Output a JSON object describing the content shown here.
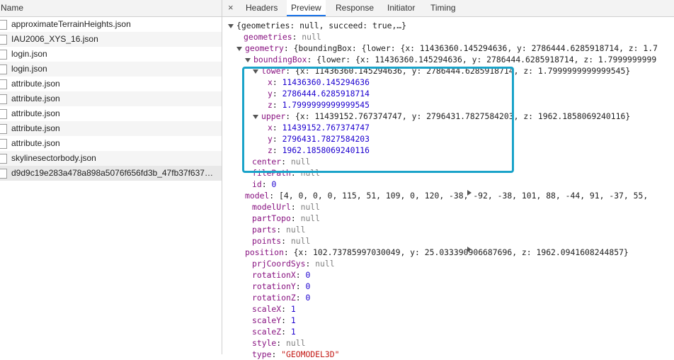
{
  "left_panel": {
    "header": "Name",
    "files": [
      "approximateTerrainHeights.json",
      "IAU2006_XYS_16.json",
      "login.json",
      "login.json",
      "attribute.json",
      "attribute.json",
      "attribute.json",
      "attribute.json",
      "attribute.json",
      "skylinesectorbody.json",
      "d9d9c19e283a478a898a5076f656fd3b_47fb37f637…"
    ]
  },
  "tabs": {
    "close": "×",
    "items": [
      "Headers",
      "Preview",
      "Response",
      "Initiator",
      "Timing"
    ],
    "active": "Preview"
  },
  "preview": {
    "root": "{geometries: null, succeed: true,…}",
    "geometries_key": "geometries",
    "geometry_key": "geometry",
    "geometry_summary": "{boundingBox: {lower: {x: 11436360.145294636, y: 2786444.6285918714, z: 1.7",
    "boundingBox_key": "boundingBox",
    "boundingBox_summary": "{lower: {x: 11436360.145294636, y: 2786444.6285918714, z: 1.7999999999",
    "lower_key": "lower",
    "lower_summary": "{x: 11436360.145294636, y: 2786444.6285918714, z: 1.7999999999999545}",
    "lower_x": "11436360.145294636",
    "lower_y": "2786444.6285918714",
    "lower_z": "1.7999999999999545",
    "upper_key": "upper",
    "upper_summary": "{x: 11439152.767374747, y: 2796431.7827584203, z: 1962.1858069240116}",
    "upper_x": "11439152.767374747",
    "upper_y": "2796431.7827584203",
    "upper_z": "1962.1858069240116",
    "null_text": "null",
    "id_val": "0",
    "model_summary": "[4, 0, 0, 0, 115, 51, 109, 0, 120, -38, -92, -38, 101, 88, -44, 91, -37, 55,",
    "position_summary": "{x: 102.73785997030049, y: 25.033390906687696, z: 1962.0941608244857}",
    "rotation_val": "0",
    "scale_val": "1",
    "type_val": "\"GEOMODEL3D\""
  }
}
